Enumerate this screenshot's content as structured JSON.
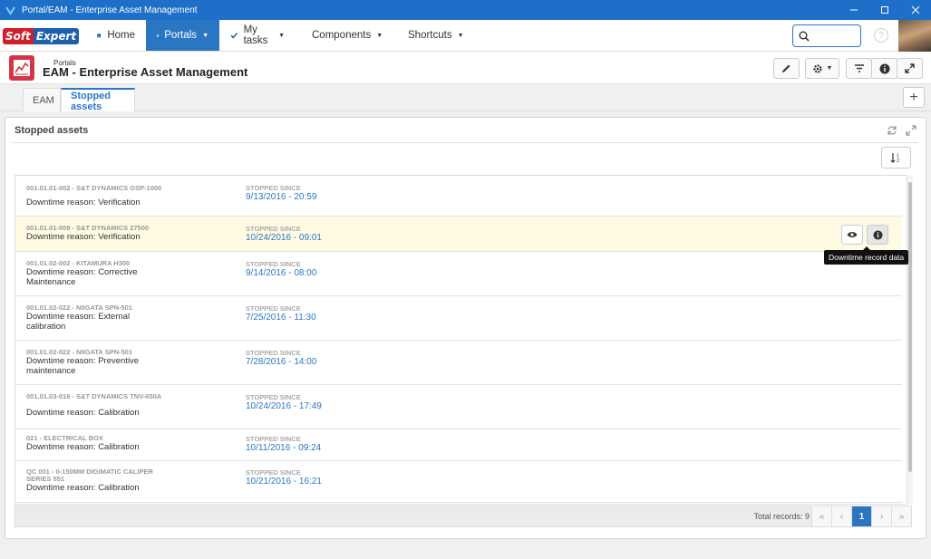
{
  "window": {
    "title": "Portal/EAM - Enterprise Asset Management"
  },
  "nav": {
    "logo_left": "Soft",
    "logo_right": "Expert",
    "home": "Home",
    "portals": "Portals",
    "my_tasks": "My tasks",
    "components": "Components",
    "shortcuts": "Shortcuts",
    "help": "?"
  },
  "header": {
    "breadcrumb": "Portals",
    "title": "EAM - Enterprise Asset Management"
  },
  "tabs": [
    {
      "label": "EAM"
    },
    {
      "label": "Stopped assets"
    }
  ],
  "panel": {
    "title": "Stopped assets"
  },
  "colors": {
    "accent": "#2b76c2",
    "titlebar": "#1d6fc8",
    "highlight": "#fffbe3"
  },
  "records": [
    {
      "asset": "001.01.01-002 - S&T DYNAMICS GSP-1000",
      "reason": "Downtime reason: Verification",
      "since_label": "STOPPED SINCE",
      "since": "9/13/2016 - 20:59"
    },
    {
      "asset": "001.01.01-009 - S&T DYNAMICS 27500",
      "reason": "Downtime reason: Verification",
      "since_label": "STOPPED SINCE",
      "since": "10/24/2016 - 09:01"
    },
    {
      "asset": "001.01.02-002 - KITAMURA H300",
      "reason": "Downtime reason: Corrective Maintenance",
      "since_label": "STOPPED SINCE",
      "since": "9/14/2016 - 08:00"
    },
    {
      "asset": "001.01.02-022 - NIIGATA SPN-501",
      "reason": "Downtime reason: External calibration",
      "since_label": "STOPPED SINCE",
      "since": "7/25/2016 - 11:30"
    },
    {
      "asset": "001.01.02-022 - NIIGATA SPN-501",
      "reason": "Downtime reason: Preventive maintenance",
      "since_label": "STOPPED SINCE",
      "since": "7/28/2016 - 14:00"
    },
    {
      "asset": "001.01.03-016 - S&T DYNAMICS TNV-650A",
      "reason": "Downtime reason: Calibration",
      "since_label": "STOPPED SINCE",
      "since": "10/24/2016 - 17:49"
    },
    {
      "asset": "021 - ELECTRICAL BOX",
      "reason": "Downtime reason: Calibration",
      "since_label": "STOPPED SINCE",
      "since": "10/11/2016 - 09:24"
    },
    {
      "asset": "QC 001 - 0-150MM DIGIMATIC CALIPER SERIES 551",
      "reason": "Downtime reason: Calibration",
      "since_label": "STOPPED SINCE",
      "since": "10/21/2016 - 16:21"
    }
  ],
  "tooltip": "Downtime record data",
  "footer": {
    "total": "Total records: 9",
    "first": "«",
    "prev": "‹",
    "page": "1",
    "next": "›",
    "last": "»"
  }
}
